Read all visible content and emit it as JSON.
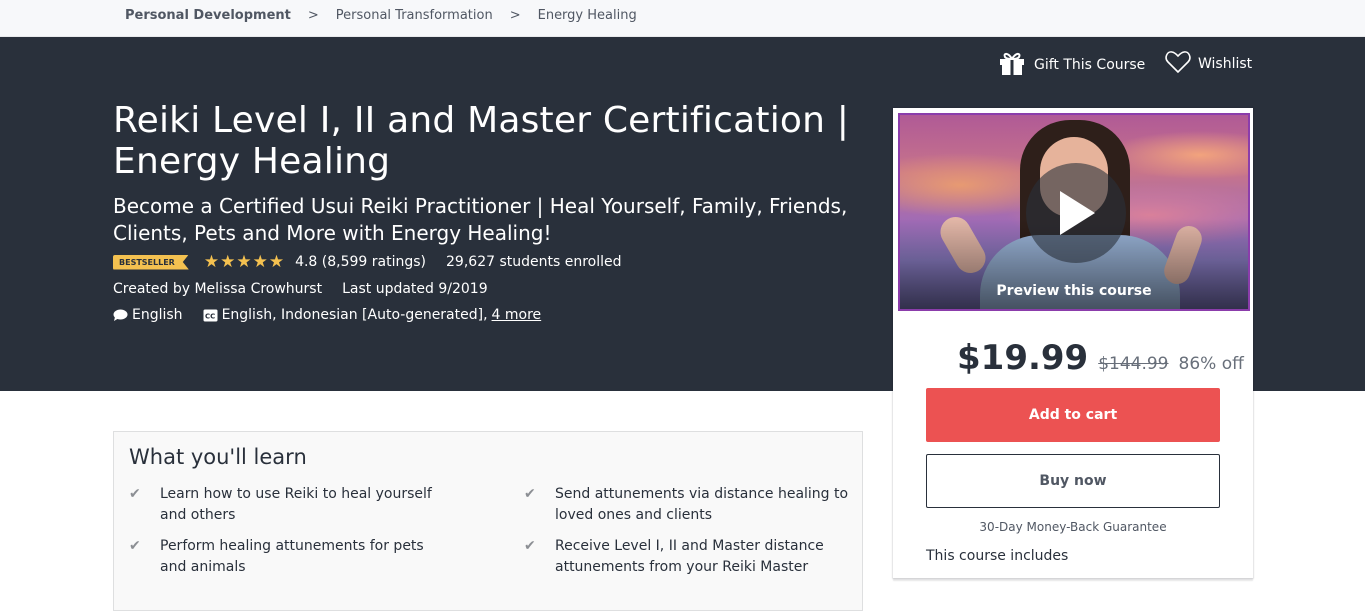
{
  "breadcrumb": {
    "items": [
      "Personal Development",
      "Personal Transformation",
      "Energy Healing"
    ],
    "separator": ">"
  },
  "header_actions": {
    "gift_label": "Gift This Course",
    "wishlist_label": "Wishlist"
  },
  "course": {
    "title": "Reiki Level I, II and Master Certification | Energy Healing",
    "subtitle": "Become a Certified Usui Reiki Practitioner | Heal Yourself, Family, Friends, Clients, Pets and More with Energy Healing!",
    "badge": "BESTSELLER",
    "rating_value": 4.8,
    "rating_text": "4.8 (8,599 ratings)",
    "enrolled": "29,627 students enrolled",
    "created_by": "Created by Melissa Crowhurst",
    "last_updated": "Last updated 9/2019",
    "language": "English",
    "captions": "English, Indonesian [Auto-generated],",
    "captions_more": "4 more"
  },
  "sidebar_card": {
    "preview_label": "Preview this course",
    "price": "$19.99",
    "original_price": "$144.99",
    "discount": "86% off",
    "add_to_cart": "Add to cart",
    "buy_now": "Buy now",
    "guarantee": "30-Day Money-Back Guarantee",
    "includes_heading": "This course includes"
  },
  "learn": {
    "heading": "What you'll learn",
    "items": [
      "Learn how to use Reiki to heal yourself and others",
      "Send attunements via distance healing to loved ones and clients",
      "Perform healing attunements for pets and animals",
      "Receive Level I, II and Master distance attunements from your Reiki Master"
    ]
  },
  "colors": {
    "hero_bg": "#29303b",
    "accent_star": "#f4c150",
    "cart_button": "#ec5252"
  }
}
